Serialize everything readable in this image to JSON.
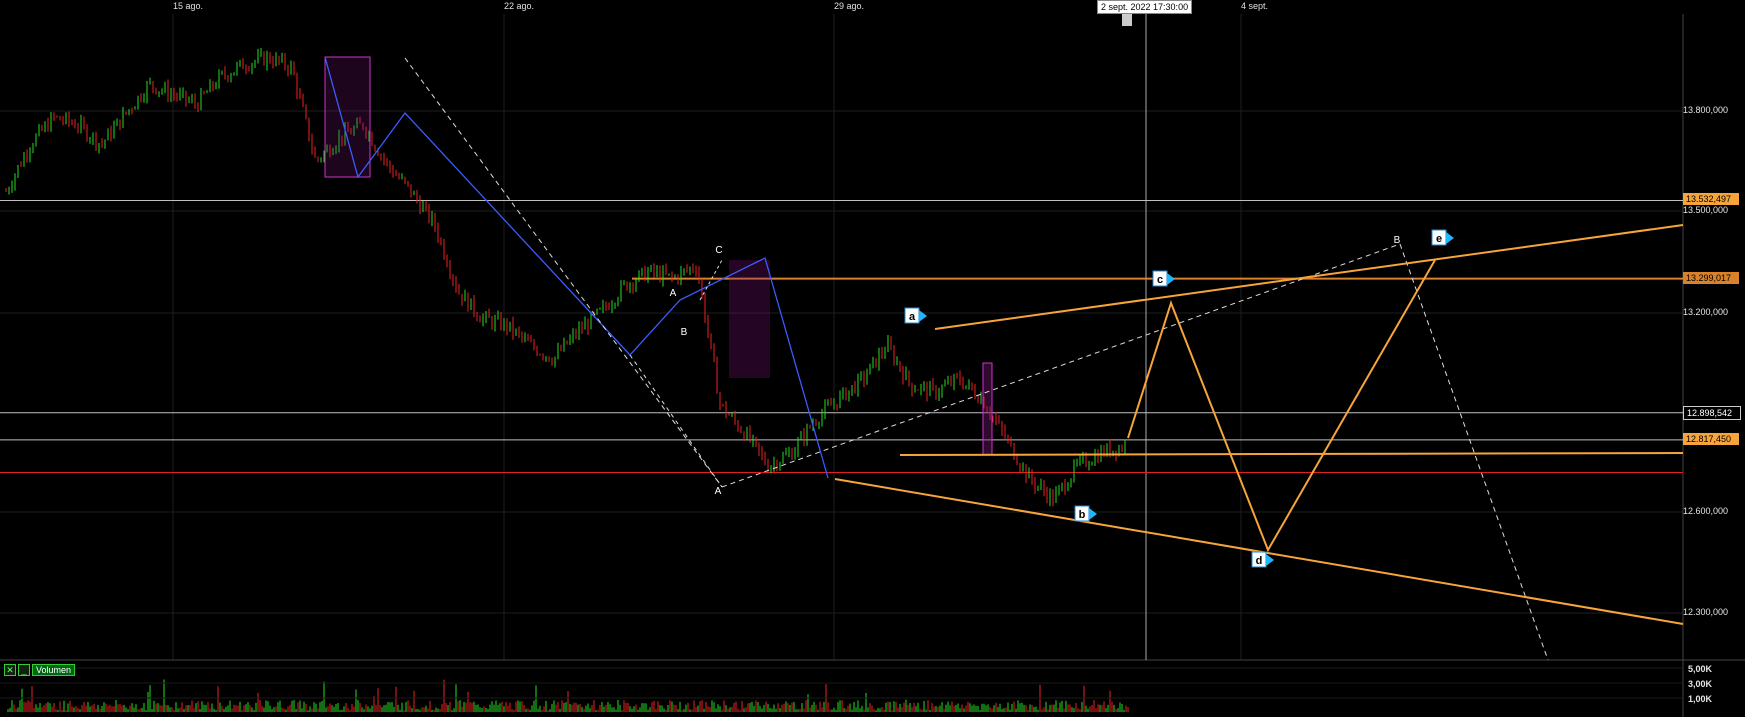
{
  "dates": [
    "15 ago.",
    "22 ago.",
    "29 ago.",
    "4 sept."
  ],
  "cursor_label": "2 sept. 2022 17:30:00",
  "price_axis": [
    "13.800,000",
    "13.500,000",
    "13.200,000",
    "12.600,000",
    "12.300,000"
  ],
  "price_tags": {
    "orange_1": "13.532,497",
    "orange_2": "13.299,017",
    "white_1": "12.898,542",
    "orange_3": "12.817,450"
  },
  "volume_legend": {
    "checkbox": "✕",
    "minimize": "_",
    "label": "Volumen"
  },
  "volume_axis": [
    "5,00K",
    "3,00K",
    "1,00K"
  ],
  "wave_labels": {
    "a": "a",
    "b": "b",
    "c": "c",
    "d": "d",
    "e": "e",
    "white_A1": "A",
    "white_B1": "B",
    "white_C": "C",
    "white_A2": "A",
    "white_B2": "B"
  },
  "colors": {
    "background": "#000000",
    "orange": "#f7a53a",
    "blue": "#3a5cff",
    "red_line": "#e02020",
    "up_candle": "#22dd22",
    "down_candle": "#ee2222",
    "purple_box": "#cc33cc",
    "marker_cyan": "#1fb5ff"
  },
  "chart_data": {
    "type": "line",
    "title": "",
    "y_scale": "price",
    "ylim": [
      12200,
      14000
    ],
    "x": [
      "15 ago.",
      "22 ago.",
      "29 ago.",
      "4 sept."
    ],
    "price_path": [
      13560,
      13700,
      13780,
      13760,
      13700,
      13790,
      13880,
      13850,
      13820,
      13900,
      13940,
      13960,
      13930,
      13650,
      13720,
      13760,
      13640,
      13560,
      13460,
      13260,
      13180,
      13160,
      13100,
      13060,
      13140,
      13200,
      13280,
      13320,
      13300,
      13340,
      12920,
      12840,
      12740,
      12780,
      12880,
      12940,
      13000,
      13100,
      12980,
      12960,
      13000,
      12940,
      12820,
      12700,
      12640,
      12740,
      12780,
      12800
    ],
    "horizontal_levels": [
      {
        "value": 13532.497,
        "color": "white"
      },
      {
        "value": 13299.017,
        "color": "orange"
      },
      {
        "value": 12898.542,
        "color": "white"
      },
      {
        "value": 12817.45,
        "color": "white"
      },
      {
        "value": 12720,
        "color": "red"
      }
    ],
    "volume_ylim": [
      0,
      5000
    ]
  }
}
